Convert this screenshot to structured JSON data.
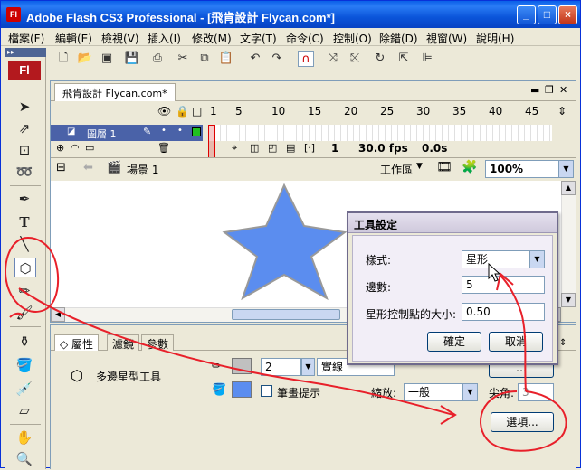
{
  "window": {
    "title": "Adobe Flash CS3 Professional - [飛肯設計  Flycan.com*]",
    "app_icon": "Fl"
  },
  "menu": [
    "檔案(F)",
    "編輯(E)",
    "檢視(V)",
    "插入(I)",
    "修改(M)",
    "文字(T)",
    "命令(C)",
    "控制(O)",
    "除錯(D)",
    "視窗(W)",
    "說明(H)"
  ],
  "document": {
    "tab_title": "飛肯設計  Flycan.com*"
  },
  "timeline": {
    "frame_numbers": [
      "1",
      "5",
      "10",
      "15",
      "20",
      "25",
      "30",
      "35",
      "40",
      "45"
    ],
    "layer_name": "圖層 1",
    "current_frame": "1",
    "fps": "30.0 fps",
    "elapsed": "0.0s"
  },
  "editbar": {
    "scene": "場景 1",
    "workspace": "工作區",
    "zoom": "100%"
  },
  "properties": {
    "tabs": [
      "屬性",
      "濾鏡",
      "參數"
    ],
    "tool_name": "多邊星型工具",
    "stroke_width": "2",
    "stroke_style": "實線",
    "stroke_hint_label": "筆畫提示",
    "scale_label": "縮放:",
    "scale_value": "一般",
    "miter_label": "尖角:",
    "miter_value": "3",
    "options_button": "選項..."
  },
  "dialog": {
    "title": "工具設定",
    "style_label": "樣式:",
    "style_value": "星形",
    "sides_label": "邊數:",
    "sides_value": "5",
    "point_size_label": "星形控制點的大小:",
    "point_size_value": "0.50",
    "ok": "確定",
    "cancel": "取消"
  },
  "colors": {
    "titlebar": "#0A5FE8",
    "star_fill": "#5B8DEF",
    "star_stroke": "#999999",
    "annotation": "#E8202A",
    "layer_highlight": "#4A62A8"
  }
}
